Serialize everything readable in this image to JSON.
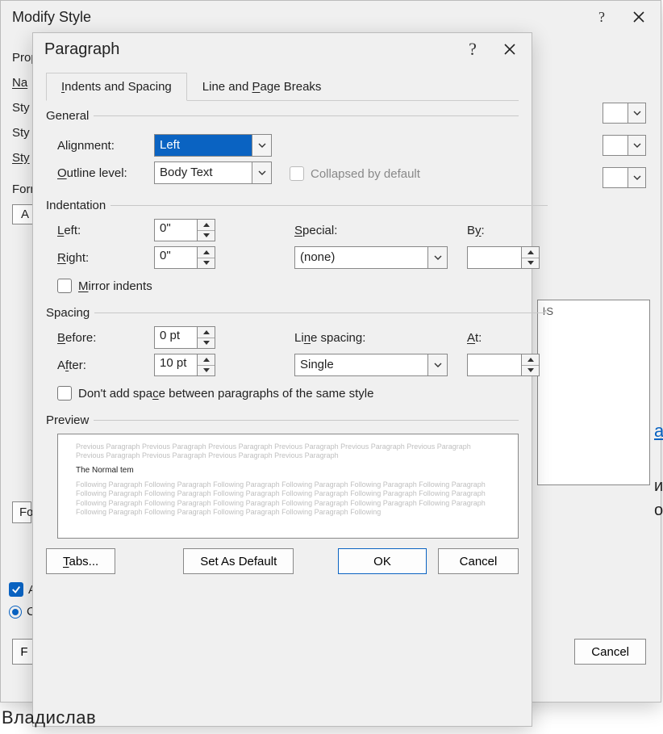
{
  "parent": {
    "title": "Modify Style",
    "propLabel": "Prop",
    "labels": {
      "name": "Na",
      "styRow": "Sty",
      "styRow2": "Sty",
      "styBold": "Sty"
    },
    "formatLabel": "Form",
    "formatBtnFragment": "A",
    "textboxFragment": "ŀS",
    "foLabel": "Fo",
    "checkALabel": "A",
    "radioCLabel": "C",
    "footerBtnFragment": "F",
    "cancel": "Cancel",
    "belowText": "Владислав",
    "blueLinkFragment": "a",
    "rightText1": "и",
    "rightText2": "о"
  },
  "dialog": {
    "title": "Paragraph",
    "tabs": {
      "indentsSpacing": "Indents and Spacing",
      "linePageBreaks": "Line and Page Breaks"
    },
    "general": {
      "legend": "General",
      "alignmentLabel": "Alignment:",
      "alignmentValue": "Left",
      "outlineLabel": "Outline level:",
      "outlineValue": "Body Text",
      "collapsedLabel": "Collapsed by default"
    },
    "indentation": {
      "legend": "Indentation",
      "leftLabel": "Left:",
      "leftValue": "0\"",
      "rightLabel": "Right:",
      "rightValue": "0\"",
      "specialLabel": "Special:",
      "specialValue": "(none)",
      "byLabel": "By:",
      "byValue": "",
      "mirrorLabel": "Mirror indents"
    },
    "spacing": {
      "legend": "Spacing",
      "beforeLabel": "Before:",
      "beforeValue": "0 pt",
      "afterLabel": "After:",
      "afterValue": "10 pt",
      "lineSpacingLabel": "Line spacing:",
      "lineSpacingValue": "Single",
      "atLabel": "At:",
      "atValue": "",
      "dontAddLabel": "Don't add space between paragraphs of the same style"
    },
    "preview": {
      "legend": "Preview",
      "prevPara": "Previous Paragraph Previous Paragraph Previous Paragraph Previous Paragraph Previous Paragraph Previous Paragraph Previous Paragraph Previous Paragraph Previous Paragraph Previous Paragraph",
      "sample": "The Normal tem",
      "followPara": "Following Paragraph Following Paragraph Following Paragraph Following Paragraph Following Paragraph Following Paragraph Following Paragraph Following Paragraph Following Paragraph Following Paragraph Following Paragraph Following Paragraph Following Paragraph Following Paragraph Following Paragraph Following Paragraph Following Paragraph Following Paragraph Following Paragraph Following Paragraph Following Paragraph Following Paragraph Following"
    },
    "buttons": {
      "tabs": "Tabs...",
      "setDefault": "Set As Default",
      "ok": "OK",
      "cancel": "Cancel"
    }
  }
}
